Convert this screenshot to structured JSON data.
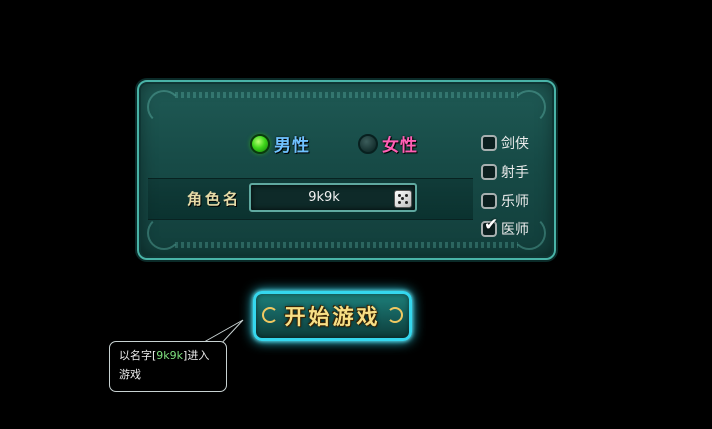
{
  "gender": {
    "male_label": "男性",
    "female_label": "女性",
    "selected": "male"
  },
  "name": {
    "label": "角色名",
    "value": "9k9k"
  },
  "classes": [
    {
      "label": "剑侠",
      "checked": false
    },
    {
      "label": "射手",
      "checked": false
    },
    {
      "label": "乐师",
      "checked": false
    },
    {
      "label": "医师",
      "checked": true
    }
  ],
  "start_button": {
    "label": "开始游戏"
  },
  "tooltip": {
    "prefix": "以名字[",
    "name": "9k9k",
    "suffix": "]进入游戏"
  },
  "colors": {
    "male": "#6fc2ff",
    "female": "#ff5fb5",
    "name_highlight": "#7ee07e",
    "button_glow": "#2ee6ff",
    "button_text": "#f7df86"
  },
  "icons": [
    "dice-icon",
    "check-icon"
  ]
}
